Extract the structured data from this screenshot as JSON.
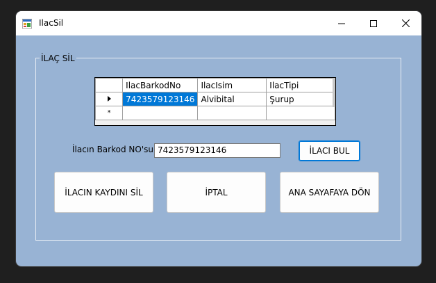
{
  "window": {
    "title": "IlacSil"
  },
  "group": {
    "label": "İLAÇ SİL"
  },
  "grid": {
    "columns": [
      "IlacBarkodNo",
      "IlacIsim",
      "IlacTipi"
    ],
    "rows": [
      [
        "7423579123146",
        "Alvibital",
        "Şurup"
      ]
    ],
    "new_row_marker": "*"
  },
  "form": {
    "barcode_label": "İlacın Barkod NO'su",
    "barcode_value": "7423579123146",
    "find_button": "İLACI BUL",
    "delete_button": "İLACIN KAYDINI SİL",
    "cancel_button": "İPTAL",
    "home_button": "ANA SAYAFAYA DÖN"
  },
  "colors": {
    "form_background": "#98b3d4",
    "selection": "#0078d7"
  }
}
